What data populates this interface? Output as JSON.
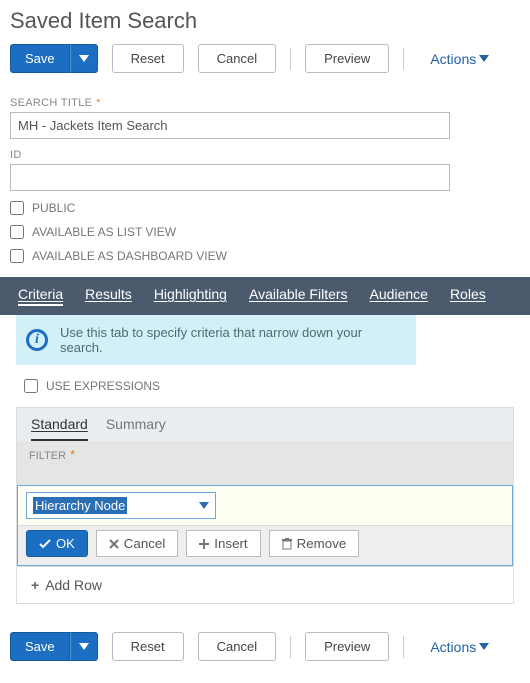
{
  "page_title": "Saved Item Search",
  "toolbar": {
    "save": "Save",
    "reset": "Reset",
    "cancel": "Cancel",
    "preview": "Preview",
    "actions": "Actions"
  },
  "form": {
    "search_title_label": "SEARCH TITLE",
    "search_title_value": "MH - Jackets Item Search",
    "id_label": "ID",
    "id_value": "",
    "public_label": "PUBLIC",
    "list_view_label": "AVAILABLE AS LIST VIEW",
    "dashboard_view_label": "AVAILABLE AS DASHBOARD VIEW"
  },
  "tabs": {
    "criteria": "Criteria",
    "results": "Results",
    "highlighting": "Highlighting",
    "available_filters": "Available Filters",
    "audience": "Audience",
    "roles": "Roles"
  },
  "info_text": "Use this tab to specify criteria that narrow down your search.",
  "use_expressions_label": "USE EXPRESSIONS",
  "sub_tabs": {
    "standard": "Standard",
    "summary": "Summary"
  },
  "filter": {
    "label": "FILTER",
    "selected": "Hierarchy Node"
  },
  "editor": {
    "ok": "OK",
    "cancel": "Cancel",
    "insert": "Insert",
    "remove": "Remove"
  },
  "add_row": "Add Row"
}
